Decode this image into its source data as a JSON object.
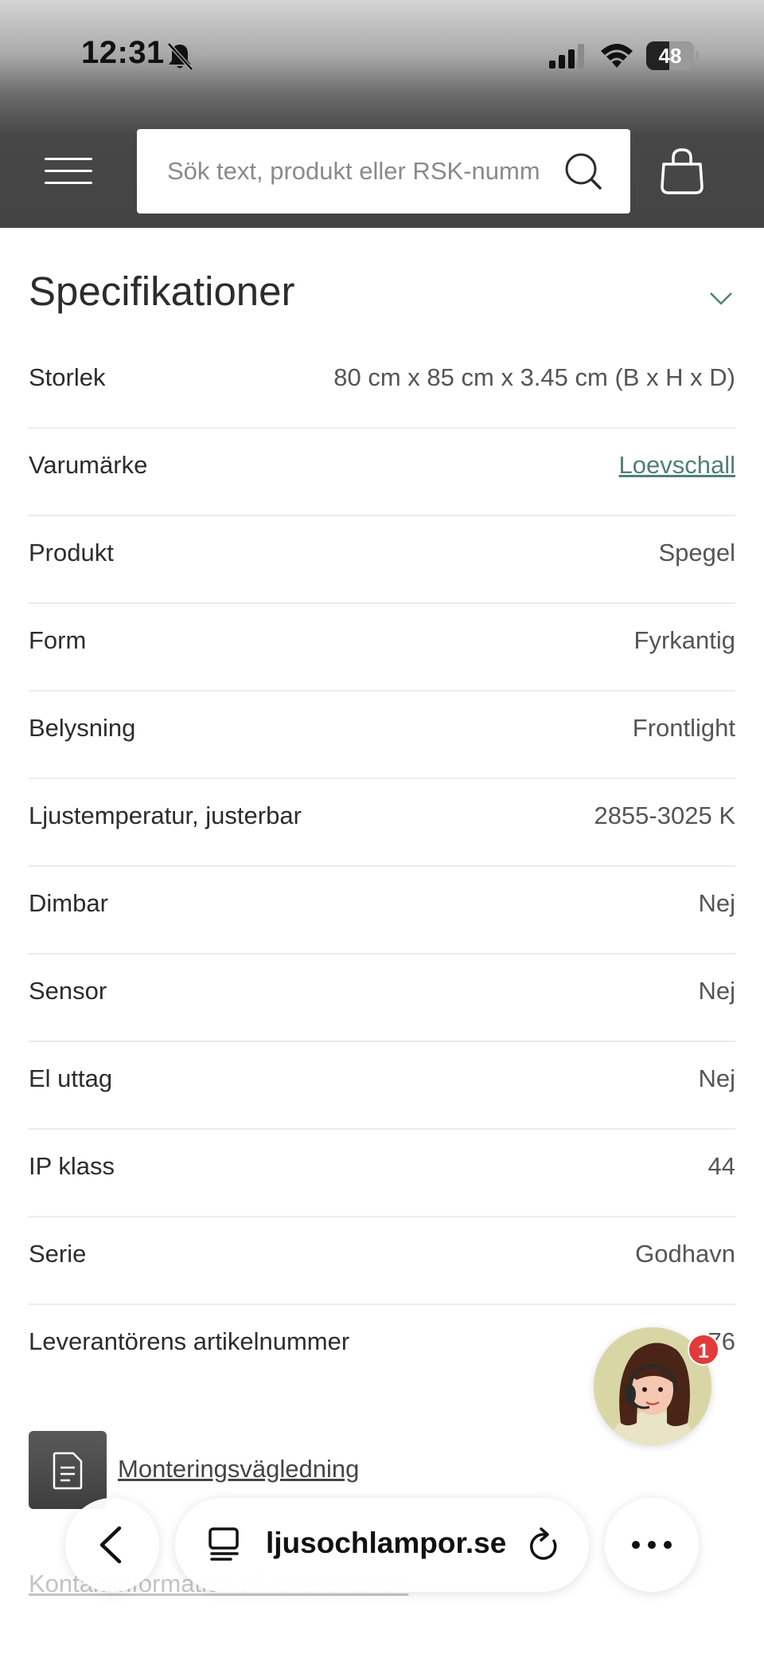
{
  "status_bar": {
    "time": "12:31",
    "battery": "48",
    "battery_level": 0.48,
    "icons": [
      "bell-slash-icon",
      "cellular-signal-icon",
      "wifi-icon",
      "battery-icon"
    ]
  },
  "header": {
    "search_placeholder": "Sök text, produkt eller RSK-nummer",
    "icons": [
      "menu-icon",
      "search-icon",
      "shopping-bag-icon"
    ]
  },
  "specs": {
    "title": "Specifikationer",
    "rows": [
      {
        "label": "Storlek",
        "value": "80 cm x 85 cm x 3.45 cm (B x H x D)"
      },
      {
        "label": "Varumärke",
        "value": "Loevschall"
      },
      {
        "label": "Produkt",
        "value": "Spegel"
      },
      {
        "label": "Form",
        "value": "Fyrkantig"
      },
      {
        "label": "Belysning",
        "value": "Frontlight"
      },
      {
        "label": "Ljustemperatur, justerbar",
        "value": "2855-3025 K"
      },
      {
        "label": "Dimbar",
        "value": "Nej"
      },
      {
        "label": "Sensor",
        "value": "Nej"
      },
      {
        "label": "El uttag",
        "value": "Nej"
      },
      {
        "label": "IP klass",
        "value": "44"
      },
      {
        "label": "Serie",
        "value": "Godhavn"
      },
      {
        "label": "Leverantörens artikelnummer",
        "value": "3 … 76"
      }
    ]
  },
  "documents": {
    "mounting_guide": "Monteringsvägledning",
    "contact_info": "Kontaktinformation till leverantören"
  },
  "chat": {
    "badge_count": "1"
  },
  "browser_bar": {
    "url": "ljusochlampor.se",
    "icons": [
      "back-chevron-icon",
      "tabs-icon",
      "reload-icon",
      "more-icon"
    ]
  },
  "colors": {
    "header_bg": "#444444",
    "link": "#4f8076",
    "badge": "#e23a3a",
    "divider": "#ecece6"
  }
}
